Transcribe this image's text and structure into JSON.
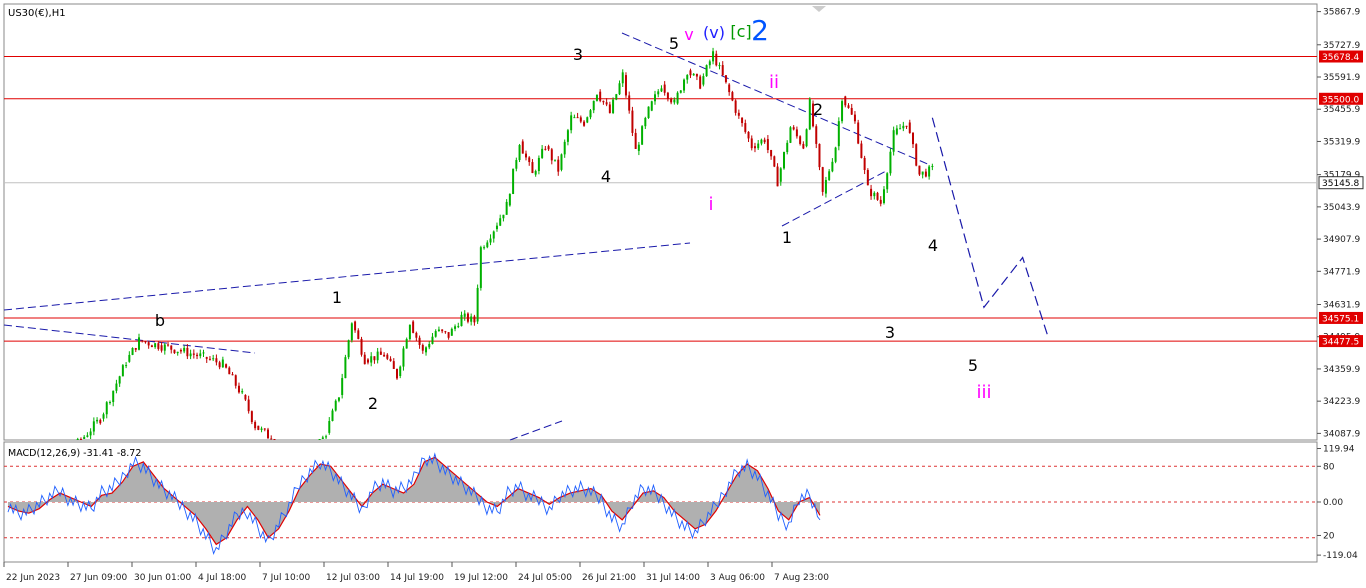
{
  "chart_data": {
    "type": "line",
    "title": "US30(€),H1",
    "symbol_icon": "chevron-down-icon",
    "price_axis": {
      "ylim": [
        34060,
        35900
      ],
      "ticks": [
        "35867.9",
        "35727.9",
        "35591.9",
        "35455.9",
        "35319.9",
        "35179.9",
        "35043.9",
        "34907.9",
        "34771.9",
        "34631.9",
        "34495.9",
        "34359.9",
        "34223.9",
        "34087.9"
      ],
      "tick_values": [
        35867.9,
        35727.9,
        35591.9,
        35455.9,
        35319.9,
        35179.9,
        35043.9,
        34907.9,
        34771.9,
        34631.9,
        34495.9,
        34359.9,
        34223.9,
        34087.9
      ]
    },
    "time_axis": {
      "labels": [
        "22 Jun 2023",
        "27 Jun 09:00",
        "30 Jun 01:00",
        "4 Jul 18:00",
        "7 Jul 10:00",
        "12 Jul 03:00",
        "14 Jul 19:00",
        "19 Jul 12:00",
        "24 Jul 05:00",
        "26 Jul 21:00",
        "31 Jul 14:00",
        "3 Aug 06:00",
        "7 Aug 23:00"
      ]
    },
    "horizontal_levels": [
      {
        "label": "35678.4",
        "value": 35678.4,
        "color": "#e00000"
      },
      {
        "label": "35500.0",
        "value": 35500.0,
        "color": "#e00000"
      },
      {
        "label": "34575.1",
        "value": 34575.1,
        "color": "#e00000"
      },
      {
        "label": "34477.5",
        "value": 34477.5,
        "color": "#e00000"
      }
    ],
    "current_price": {
      "label": "35145.8",
      "value": 35145.8
    },
    "price_path": [
      [
        0,
        33900
      ],
      [
        10,
        34030
      ],
      [
        14,
        34150
      ],
      [
        18,
        34390
      ],
      [
        20,
        34480
      ],
      [
        23,
        34460
      ],
      [
        26,
        34440
      ],
      [
        30,
        34410
      ],
      [
        33,
        34380
      ],
      [
        36,
        34250
      ],
      [
        38,
        34120
      ],
      [
        46,
        33950
      ],
      [
        49,
        34090
      ],
      [
        51,
        34250
      ],
      [
        53,
        34560
      ],
      [
        55,
        34400
      ],
      [
        58,
        34420
      ],
      [
        60,
        34330
      ],
      [
        62,
        34560
      ],
      [
        64,
        34430
      ],
      [
        66,
        34520
      ],
      [
        68,
        34500
      ],
      [
        70,
        34580
      ],
      [
        72,
        34560
      ],
      [
        73,
        34870
      ],
      [
        75,
        34950
      ],
      [
        77,
        35050
      ],
      [
        79,
        35320
      ],
      [
        81,
        35180
      ],
      [
        83,
        35300
      ],
      [
        85,
        35200
      ],
      [
        87,
        35420
      ],
      [
        89,
        35400
      ],
      [
        91,
        35530
      ],
      [
        93,
        35440
      ],
      [
        95,
        35600
      ],
      [
        97,
        35280
      ],
      [
        99,
        35450
      ],
      [
        101,
        35560
      ],
      [
        103,
        35480
      ],
      [
        105,
        35620
      ],
      [
        107,
        35560
      ],
      [
        109,
        35690
      ],
      [
        111,
        35560
      ],
      [
        113,
        35420
      ],
      [
        115,
        35300
      ],
      [
        117,
        35330
      ],
      [
        119,
        35150
      ],
      [
        121,
        35380
      ],
      [
        123,
        35300
      ],
      [
        124,
        35480
      ],
      [
        126,
        35100
      ],
      [
        128,
        35300
      ],
      [
        129,
        35510
      ],
      [
        131,
        35400
      ],
      [
        133,
        35120
      ],
      [
        135,
        35060
      ],
      [
        137,
        35350
      ],
      [
        139,
        35400
      ],
      [
        141,
        35180
      ],
      [
        143,
        35200
      ]
    ],
    "macd": {
      "label": "MACD(12,26,9) -31.41 -8.72",
      "ylim": [
        -130,
        130
      ],
      "levels": [
        80,
        0,
        -80
      ],
      "ticks": [
        "119.94",
        "80",
        "0.00",
        "20",
        "-119.04"
      ],
      "tick_values": [
        119.94,
        80,
        0,
        -75,
        -119.04
      ],
      "colors": {
        "histogram": "#b0b0b0",
        "signal": "#e00000",
        "level": "#d33",
        "macd_line": "#2060ff"
      },
      "histogram": [
        -10,
        -20,
        -25,
        -15,
        5,
        20,
        10,
        0,
        -10,
        15,
        20,
        45,
        80,
        90,
        60,
        30,
        10,
        -10,
        -30,
        -60,
        -95,
        -80,
        -40,
        -10,
        -40,
        -80,
        -60,
        -20,
        30,
        60,
        85,
        80,
        50,
        20,
        -10,
        20,
        40,
        30,
        20,
        40,
        90,
        100,
        80,
        60,
        40,
        20,
        0,
        -10,
        10,
        30,
        20,
        10,
        -5,
        10,
        20,
        25,
        30,
        15,
        -20,
        -40,
        -10,
        20,
        25,
        10,
        -20,
        -40,
        -60,
        -50,
        -20,
        20,
        60,
        85,
        70,
        30,
        -20,
        -40,
        0,
        10,
        -30
      ],
      "macd_line": [
        -5,
        -25,
        -20,
        -5,
        10,
        25,
        5,
        -5,
        -15,
        20,
        30,
        55,
        90,
        80,
        50,
        25,
        5,
        -15,
        -40,
        -75,
        -110,
        -70,
        -30,
        -20,
        -55,
        -90,
        -50,
        -10,
        40,
        70,
        90,
        70,
        40,
        10,
        -20,
        30,
        45,
        25,
        30,
        50,
        100,
        95,
        70,
        50,
        30,
        10,
        -10,
        -20,
        20,
        35,
        10,
        5,
        -15,
        15,
        25,
        30,
        20,
        5,
        -35,
        -55,
        0,
        30,
        20,
        0,
        -30,
        -55,
        -70,
        -40,
        -10,
        30,
        70,
        80,
        55,
        15,
        -30,
        -50,
        10,
        15,
        -40
      ]
    },
    "wave_labels": [
      {
        "text": "b",
        "color": "#000000"
      },
      {
        "text": "1",
        "color": "#000000"
      },
      {
        "text": "2",
        "color": "#000000"
      },
      {
        "text": "3",
        "color": "#000000"
      },
      {
        "text": "4",
        "color": "#000000"
      },
      {
        "text": "5",
        "color": "#000000"
      },
      {
        "text": "v",
        "color": "#ff00ff"
      },
      {
        "text": "(v)",
        "color": "#2020ff"
      },
      {
        "text": "[c]",
        "color": "#009900"
      },
      {
        "text": "2",
        "color": "#0055ff"
      },
      {
        "text": "ii",
        "color": "#ff00ff"
      },
      {
        "text": "i",
        "color": "#ff00ff"
      },
      {
        "text": "2",
        "color": "#000000"
      },
      {
        "text": "1",
        "color": "#000000"
      },
      {
        "text": "4",
        "color": "#000000"
      },
      {
        "text": "3",
        "color": "#000000"
      },
      {
        "text": "5",
        "color": "#000000"
      },
      {
        "text": "iii",
        "color": "#ff00ff"
      }
    ],
    "projection_path": [
      [
        143,
        35420
      ],
      [
        151,
        34620
      ],
      [
        157,
        34830
      ],
      [
        161,
        34490
      ]
    ],
    "colors": {
      "bull": "#00b000",
      "bear": "#c00000",
      "trendline": "#1a1aaa",
      "grid_text": "#333333"
    }
  }
}
